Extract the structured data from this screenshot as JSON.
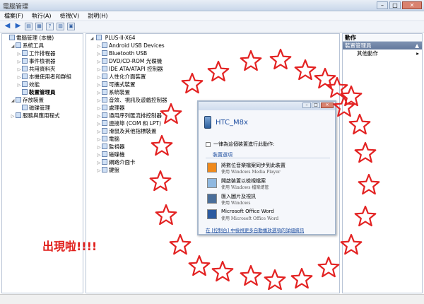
{
  "window": {
    "title": "電腦管理"
  },
  "menu": [
    "檔案(F)",
    "執行(A)",
    "檢視(V)",
    "說明(H)"
  ],
  "left_tree": [
    {
      "label": "電腦管理 (本機)",
      "level": 0,
      "expander": ""
    },
    {
      "label": "系統工具",
      "level": 1,
      "expander": "◢"
    },
    {
      "label": "工作排程器",
      "level": 2,
      "expander": "▷"
    },
    {
      "label": "事件檢視器",
      "level": 2,
      "expander": "▷"
    },
    {
      "label": "共用資料夾",
      "level": 2,
      "expander": "▷"
    },
    {
      "label": "本機使用者和群組",
      "level": 2,
      "expander": "▷"
    },
    {
      "label": "效能",
      "level": 2,
      "expander": "▷"
    },
    {
      "label": "裝置管理員",
      "level": 2,
      "expander": "",
      "selected": true
    },
    {
      "label": "存放裝置",
      "level": 1,
      "expander": "◢"
    },
    {
      "label": "磁碟管理",
      "level": 2,
      "expander": ""
    },
    {
      "label": "服務與應用程式",
      "level": 1,
      "expander": "▷"
    }
  ],
  "device_tree": {
    "root": "PLUS-II-X64",
    "items": [
      "Android USB Devices",
      "Bluetooth USB",
      "DVD/CD-ROM 光碟機",
      "IDE ATA/ATAPI 控制器",
      "人性化介面裝置",
      "可攜式裝置",
      "系統裝置",
      "音效、視訊及遊戲控制器",
      "處理器",
      "通用序列匯流排控制器",
      "連接埠 (COM 和 LPT)",
      "滑鼠及其他指標裝置",
      "電腦",
      "監視器",
      "磁碟機",
      "網路介面卡",
      "鍵盤"
    ]
  },
  "actions_pane": {
    "header": "動作",
    "section": "裝置管理員",
    "items": [
      "其他動作"
    ]
  },
  "autoplay_dialog": {
    "device_name": "HTC_M8x",
    "always_do": "一律為這個裝置進行此動作:",
    "section_label": "裝置選項",
    "options": [
      {
        "line1": "將數位音樂檔案同步到此裝置",
        "line2": "使用 Windows Media Player",
        "icon": "media-player-icon",
        "color": "#f08a1c"
      },
      {
        "line1": "開啟裝置以檢視檔案",
        "line2": "使用 Windows 檔案總管",
        "icon": "folder-icon",
        "color": "#8fb8e0"
      },
      {
        "line1": "匯入圖片及視訊",
        "line2": "使用 Windows",
        "icon": "import-camera-icon",
        "color": "#4a6e9a"
      },
      {
        "line1": "Microsoft Office Word",
        "line2": "使用 Microsoft Office Word",
        "icon": "word-icon",
        "color": "#2b5aa0"
      }
    ],
    "control_panel_link": "在 [控制台] 中檢視更多自動播放選項的詳細資訊"
  },
  "annotation": {
    "text": "出現啦!!!!",
    "color": "#e0201c"
  },
  "decoration": {
    "star_color": "#e32222",
    "star_count": 25
  }
}
